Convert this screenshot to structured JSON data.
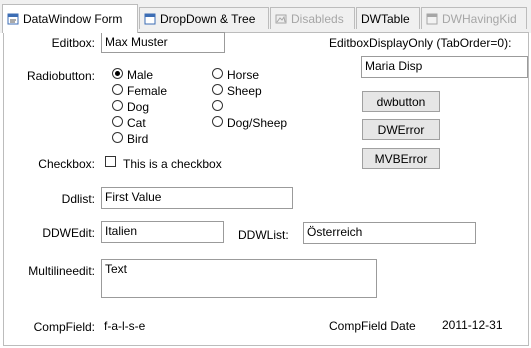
{
  "tabs": [
    {
      "label": "DataWindow Form",
      "icon": "form-icon"
    },
    {
      "label": "DropDown & Tree",
      "icon": "window-icon"
    },
    {
      "label": "Disableds",
      "icon": "image-icon"
    },
    {
      "label": "DWTable",
      "icon": ""
    },
    {
      "label": "DWHavingKid",
      "icon": "window-icon"
    }
  ],
  "form": {
    "editbox_label": "Editbox:",
    "editbox_value": "Max Muster",
    "display_only_label": "EditboxDisplayOnly (TabOrder=0):",
    "display_only_value": "Maria Disp",
    "radio_label": "Radiobutton:",
    "radio_left": [
      "Male",
      "Female",
      "Dog",
      "Cat",
      "Bird"
    ],
    "radio_right": [
      "Horse",
      "Sheep",
      "",
      "Dog/Sheep"
    ],
    "radio_selected": "Male",
    "checkbox_label": "Checkbox:",
    "checkbox_text": "This is a checkbox",
    "ddlist_label": "Ddlist:",
    "ddlist_value": "First Value",
    "ddwedit_label": "DDWEdit:",
    "ddwedit_value": "Italien",
    "ddwlist_label": "DDWList:",
    "ddwlist_value": "Österreich",
    "multiline_label": "Multilineedit:",
    "multiline_value": "Text",
    "compfield_label": "CompField:",
    "compfield_value": "f-a-l-s-e",
    "compfield_date_label": "CompField Date",
    "compfield_date_value": "2011-12-31"
  },
  "buttons": {
    "dw": "dwbutton",
    "dwerror": "DWError",
    "mvberror": "MVBError"
  }
}
